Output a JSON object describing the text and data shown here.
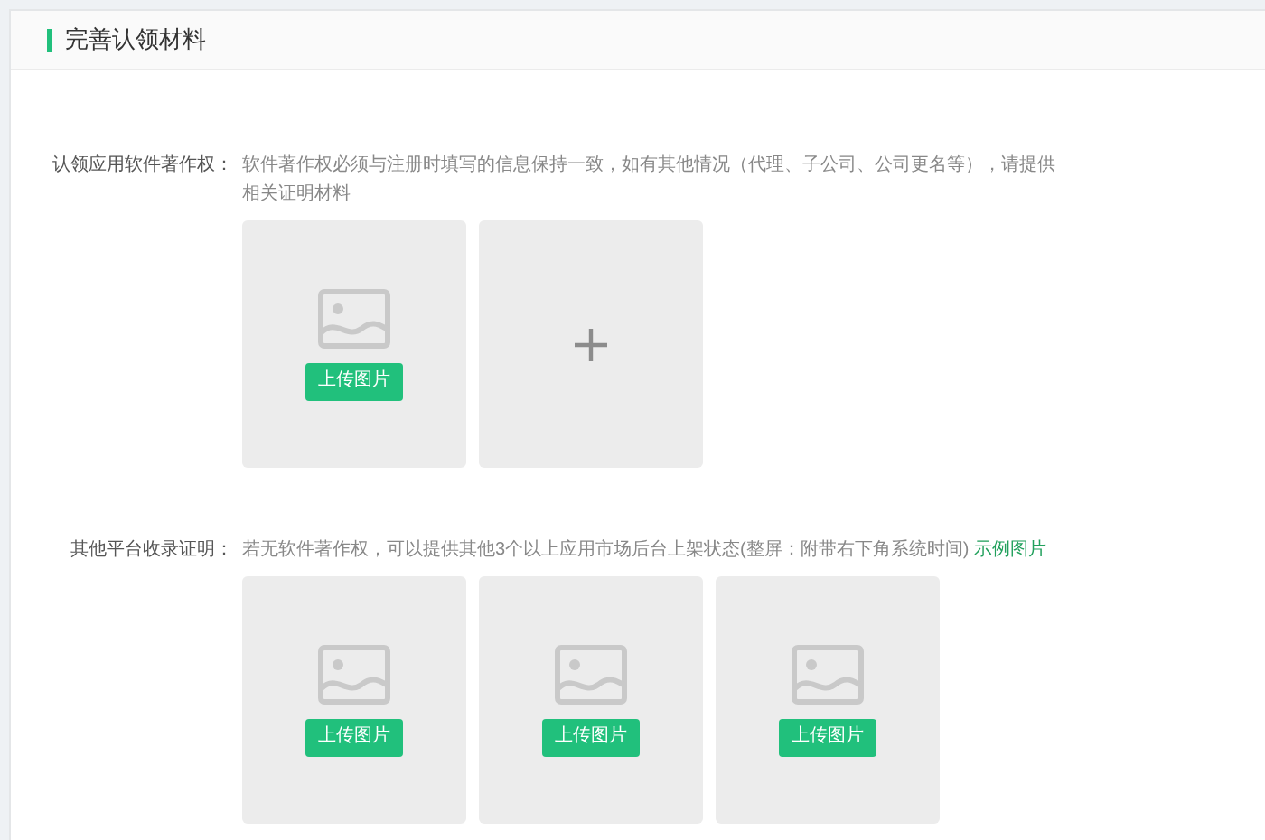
{
  "header": {
    "title": "完善认领材料"
  },
  "sections": [
    {
      "label": "认领应用软件著作权：",
      "note": "软件著作权必须与注册时填写的信息保持一致，如有其他情况（代理、子公司、公司更名等），请提供相关证明材料",
      "tiles": [
        {
          "kind": "upload",
          "button": "上传图片"
        },
        {
          "kind": "add"
        }
      ]
    },
    {
      "label": "其他平台收录证明：",
      "note": "若无软件著作权，可以提供其他3个以上应用市场后台上架状态(整屏：附带右下角系统时间)",
      "link": "示例图片",
      "tiles": [
        {
          "kind": "upload",
          "button": "上传图片"
        },
        {
          "kind": "upload",
          "button": "上传图片"
        },
        {
          "kind": "upload",
          "button": "上传图片"
        }
      ]
    }
  ]
}
